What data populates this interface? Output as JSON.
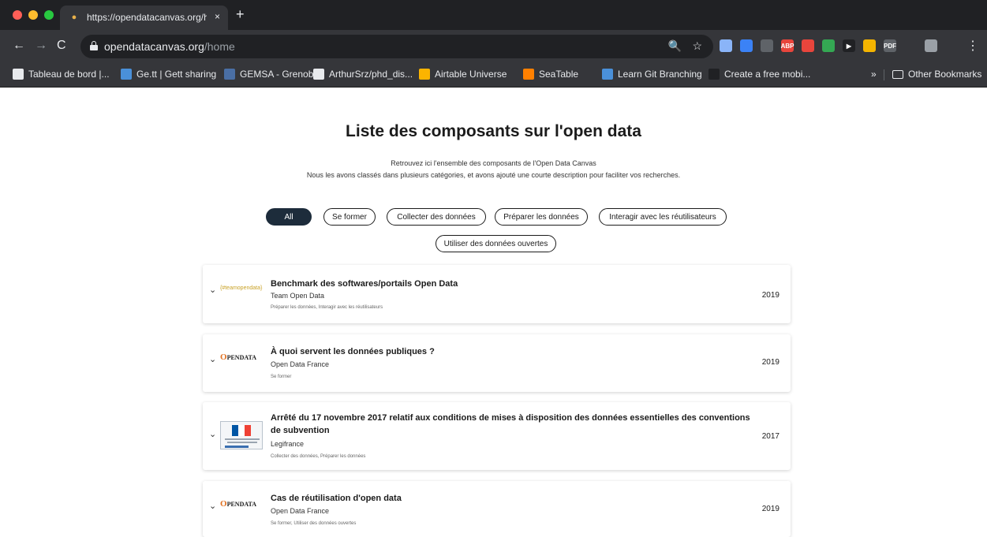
{
  "browser": {
    "tab_title": "https://opendatacanvas.org/ho",
    "tab_close": "×",
    "new_tab": "+",
    "nav": {
      "back": "←",
      "forward": "→",
      "reload": "C"
    },
    "url_host": "opendatacanvas.org",
    "url_path": "/home",
    "zoom_icon": "🔍",
    "star_icon": "☆",
    "menu": "⋮",
    "extensions": [
      {
        "name": "docs-icon",
        "label": "",
        "color": "#8ab4f8"
      },
      {
        "name": "shield-icon",
        "label": "",
        "color": "#3b82f6"
      },
      {
        "name": "block-icon",
        "label": "",
        "color": "#5f6368"
      },
      {
        "name": "abp-icon",
        "label": "ABP",
        "color": "#e8453c"
      },
      {
        "name": "stop-icon",
        "label": "",
        "color": "#e8453c"
      },
      {
        "name": "headphones-icon",
        "label": "",
        "color": "#34a853"
      },
      {
        "name": "play-icon",
        "label": "▶",
        "color": "#202124"
      },
      {
        "name": "tag-icon",
        "label": "",
        "color": "#f4b400"
      },
      {
        "name": "pdf-icon",
        "label": "PDF",
        "color": "#5f6368"
      },
      {
        "name": "puzzle-icon",
        "label": "",
        "color": "#35363a"
      },
      {
        "name": "profile-icon",
        "label": "",
        "color": "#9aa0a6"
      }
    ],
    "bookmarks": [
      {
        "label": "Tableau de bord |...",
        "color": "#e8eaed"
      },
      {
        "label": "Ge.tt | Gett sharing",
        "color": "#4a90d9"
      },
      {
        "label": "GEMSA - Grenobl...",
        "color": "#4a6fa5"
      },
      {
        "label": "ArthurSrz/phd_dis...",
        "color": "#e8eaed"
      },
      {
        "label": "Airtable Universe",
        "color": "#fcb400"
      },
      {
        "label": "SeaTable",
        "color": "#ff8000"
      },
      {
        "label": "Learn Git Branching",
        "color": "#4a90d9"
      },
      {
        "label": "Create a free mobi...",
        "color": "#202124"
      }
    ],
    "bookmarks_more": "»",
    "other_bookmarks": "Other Bookmarks"
  },
  "page": {
    "title": "Liste des composants sur l'open data",
    "intro_line1": "Retrouvez ici l'ensemble des composants de l'Open Data Canvas",
    "intro_line2": "Nous les avons classés dans plusieurs catégories, et avons ajouté une courte description pour faciliter vos recherches.",
    "filters": [
      "All",
      "Se former",
      "Collecter des données",
      "Préparer les données",
      "Interagir avec les réutilisateurs",
      "Utiliser des données ouvertes"
    ],
    "active_filter": "All",
    "cards": [
      {
        "title": "Benchmark des softwares/portails Open Data",
        "author": "Team Open Data",
        "categories": "Préparer les données, Interagir avec les réutilisateurs",
        "year": "2019",
        "logo_text": "{#teamopendata}"
      },
      {
        "title": "À quoi servent les données publiques ?",
        "author": "Open Data France",
        "categories": "Se former",
        "year": "2019",
        "logo_text": "PENDATA"
      },
      {
        "title": "Arrêté du 17 novembre 2017 relatif aux conditions de mises à disposition des données essentielles des conventions de subvention",
        "author": "Legifrance",
        "categories": "Collecter des données, Préparer les données",
        "year": "2017",
        "logo_text": ""
      },
      {
        "title": "Cas de réutilisation d'open data",
        "author": "Open Data France",
        "categories": "Se former, Utiliser des données ouvertes",
        "year": "2019",
        "logo_text": "PENDATA"
      }
    ]
  }
}
